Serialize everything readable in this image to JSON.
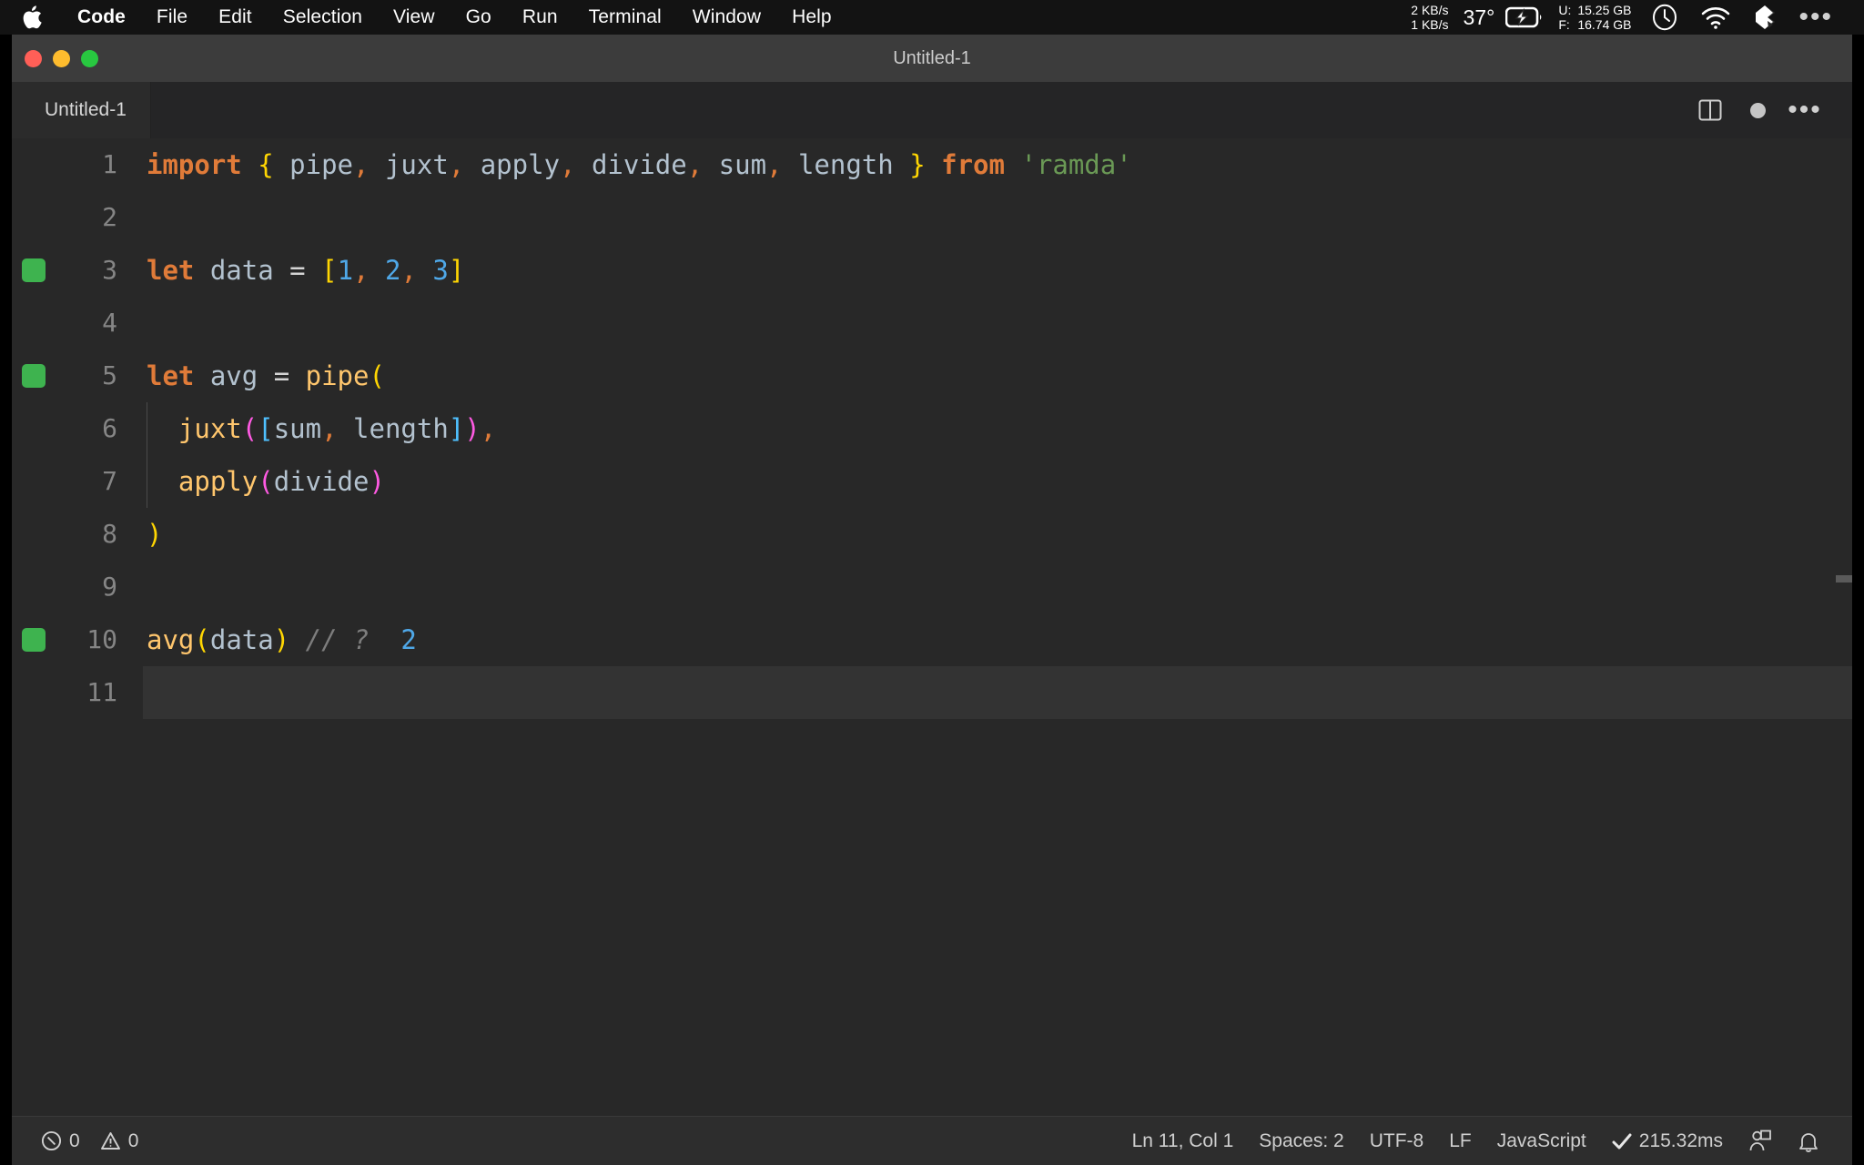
{
  "menubar": {
    "apple_icon": "apple-logo-icon",
    "items": [
      {
        "label": "Code",
        "bold": true
      },
      {
        "label": "File",
        "bold": false
      },
      {
        "label": "Edit",
        "bold": false
      },
      {
        "label": "Selection",
        "bold": false
      },
      {
        "label": "View",
        "bold": false
      },
      {
        "label": "Go",
        "bold": false
      },
      {
        "label": "Run",
        "bold": false
      },
      {
        "label": "Terminal",
        "bold": false
      },
      {
        "label": "Window",
        "bold": false
      },
      {
        "label": "Help",
        "bold": false
      }
    ],
    "tray": {
      "net_up": "2 KB/s",
      "net_down": "1 KB/s",
      "temperature": "37°",
      "battery_icon": "battery-charging-icon",
      "mem_used_label": "U:",
      "mem_used_value": "15.25 GB",
      "mem_free_label": "F:",
      "mem_free_value": "16.74 GB",
      "clock_icon": "clock-icon",
      "wifi_icon": "wifi-icon",
      "dropbox_icon": "dropbox-icon",
      "more_icon": "control-center-more-icon"
    }
  },
  "window": {
    "title": "Untitled-1",
    "traffic_lights": {
      "close": "close-window-button",
      "minimize": "minimize-window-button",
      "maximize": "maximize-window-button"
    }
  },
  "tabs": [
    {
      "label": "Untitled-1",
      "active": true
    }
  ],
  "tab_actions": {
    "split_editor": "split-editor-icon",
    "unsaved_indicator": "unsaved-dot-icon",
    "more_actions": "more-actions-icon"
  },
  "editor": {
    "language": "JavaScript",
    "lines": [
      {
        "number": "1",
        "marker": false,
        "guide": false,
        "current": false,
        "tokens": [
          {
            "text": "import",
            "cls": "t-key"
          },
          {
            "text": " ",
            "cls": "t-var"
          },
          {
            "text": "{",
            "cls": "b-yellow"
          },
          {
            "text": " pipe",
            "cls": "t-var"
          },
          {
            "text": ",",
            "cls": "t-punct"
          },
          {
            "text": " juxt",
            "cls": "t-var"
          },
          {
            "text": ",",
            "cls": "t-punct"
          },
          {
            "text": " apply",
            "cls": "t-var"
          },
          {
            "text": ",",
            "cls": "t-punct"
          },
          {
            "text": " divide",
            "cls": "t-var"
          },
          {
            "text": ",",
            "cls": "t-punct"
          },
          {
            "text": " sum",
            "cls": "t-var"
          },
          {
            "text": ",",
            "cls": "t-punct"
          },
          {
            "text": " length ",
            "cls": "t-var"
          },
          {
            "text": "}",
            "cls": "b-yellow"
          },
          {
            "text": " ",
            "cls": "t-var"
          },
          {
            "text": "from",
            "cls": "t-key"
          },
          {
            "text": " ",
            "cls": "t-var"
          },
          {
            "text": "'ramda'",
            "cls": "t-str"
          }
        ]
      },
      {
        "number": "2",
        "marker": false,
        "guide": false,
        "current": false,
        "tokens": []
      },
      {
        "number": "3",
        "marker": true,
        "guide": false,
        "current": false,
        "tokens": [
          {
            "text": "let",
            "cls": "t-key"
          },
          {
            "text": " data ",
            "cls": "t-var"
          },
          {
            "text": "=",
            "cls": "t-op"
          },
          {
            "text": " ",
            "cls": "t-var"
          },
          {
            "text": "[",
            "cls": "b-yellow"
          },
          {
            "text": "1",
            "cls": "t-num"
          },
          {
            "text": ",",
            "cls": "t-punct"
          },
          {
            "text": " ",
            "cls": "t-var"
          },
          {
            "text": "2",
            "cls": "t-num"
          },
          {
            "text": ",",
            "cls": "t-punct"
          },
          {
            "text": " ",
            "cls": "t-var"
          },
          {
            "text": "3",
            "cls": "t-num"
          },
          {
            "text": "]",
            "cls": "b-yellow"
          }
        ]
      },
      {
        "number": "4",
        "marker": false,
        "guide": false,
        "current": false,
        "tokens": []
      },
      {
        "number": "5",
        "marker": true,
        "guide": false,
        "current": false,
        "tokens": [
          {
            "text": "let",
            "cls": "t-key"
          },
          {
            "text": " avg ",
            "cls": "t-var"
          },
          {
            "text": "=",
            "cls": "t-op"
          },
          {
            "text": " ",
            "cls": "t-var"
          },
          {
            "text": "pipe",
            "cls": "t-fn"
          },
          {
            "text": "(",
            "cls": "b-yellow"
          }
        ]
      },
      {
        "number": "6",
        "marker": false,
        "guide": true,
        "current": false,
        "tokens": [
          {
            "text": "  juxt",
            "cls": "t-fn"
          },
          {
            "text": "(",
            "cls": "b-magenta"
          },
          {
            "text": "[",
            "cls": "b-blue"
          },
          {
            "text": "sum",
            "cls": "t-var"
          },
          {
            "text": ",",
            "cls": "t-punct"
          },
          {
            "text": " length",
            "cls": "t-var"
          },
          {
            "text": "]",
            "cls": "b-blue"
          },
          {
            "text": ")",
            "cls": "b-magenta"
          },
          {
            "text": ",",
            "cls": "t-punct"
          }
        ]
      },
      {
        "number": "7",
        "marker": false,
        "guide": true,
        "current": false,
        "tokens": [
          {
            "text": "  apply",
            "cls": "t-fn"
          },
          {
            "text": "(",
            "cls": "b-magenta"
          },
          {
            "text": "divide",
            "cls": "t-var"
          },
          {
            "text": ")",
            "cls": "b-magenta"
          }
        ]
      },
      {
        "number": "8",
        "marker": false,
        "guide": false,
        "current": false,
        "tokens": [
          {
            "text": ")",
            "cls": "b-yellow"
          }
        ]
      },
      {
        "number": "9",
        "marker": false,
        "guide": false,
        "current": false,
        "tokens": []
      },
      {
        "number": "10",
        "marker": true,
        "guide": false,
        "current": false,
        "tokens": [
          {
            "text": "avg",
            "cls": "t-fn"
          },
          {
            "text": "(",
            "cls": "b-yellow"
          },
          {
            "text": "data",
            "cls": "t-var"
          },
          {
            "text": ")",
            "cls": "b-yellow"
          },
          {
            "text": " ",
            "cls": "t-var"
          },
          {
            "text": "// ?",
            "cls": "t-comment"
          },
          {
            "text": "  ",
            "cls": "t-var"
          },
          {
            "text": "2",
            "cls": "t-num"
          }
        ]
      },
      {
        "number": "11",
        "marker": false,
        "guide": false,
        "current": true,
        "tokens": []
      }
    ]
  },
  "statusbar": {
    "errors_icon": "error-circle-icon",
    "errors_count": "0",
    "warnings_icon": "warning-triangle-icon",
    "warnings_count": "0",
    "cursor_position": "Ln 11, Col 1",
    "indentation": "Spaces: 2",
    "encoding": "UTF-8",
    "eol": "LF",
    "language_mode": "JavaScript",
    "quokka_check_icon": "check-mark-icon",
    "quokka_time": "215.32ms",
    "remote_icon": "account-icon",
    "bell_icon": "notifications-bell-icon"
  },
  "colors": {
    "menubar_bg": "#131313",
    "titlebar_bg": "#3c3c3c",
    "editor_bg": "#282828",
    "statusbar_bg": "#2d2d2d",
    "quokka_green": "#3eb34f",
    "accent_orange": "#e07b39",
    "accent_yellow": "#ffd602",
    "accent_magenta": "#ff5ae3",
    "accent_blue": "#4fc1ff",
    "string_green": "#6a9955"
  }
}
